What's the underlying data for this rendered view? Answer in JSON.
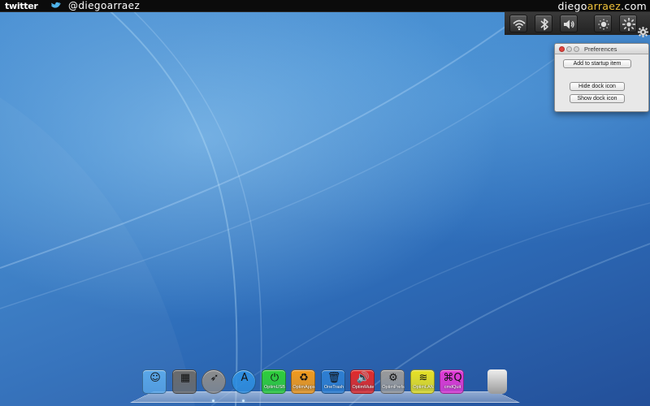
{
  "topbar": {
    "twitter_logo": "twitter",
    "handle": "@diegoarraez",
    "site_white_1": "diego",
    "site_yellow": "arraez",
    "site_white_2": ".com"
  },
  "status_panel": {
    "icons": [
      "wifi-icon",
      "bluetooth-icon",
      "volume-icon",
      "brightness-down-icon",
      "brightness-up-icon",
      "gear-icon"
    ]
  },
  "preferences": {
    "title": "Preferences",
    "add_startup": "Add to startup item",
    "hide_dock": "Hide dock icon",
    "show_dock": "Show dock icon"
  },
  "dock": {
    "items": [
      {
        "name": "finder-icon",
        "label": "",
        "color": "#5aa7e8"
      },
      {
        "name": "dashboard-icon",
        "label": "",
        "color": "#6b6b6b"
      },
      {
        "name": "launchpad-icon",
        "label": "",
        "color": "#8c8c8c"
      },
      {
        "name": "app-store-icon",
        "label": "",
        "color": "#2f8fe0"
      },
      {
        "name": "optimusb-icon",
        "label": "OptimUSB",
        "color": "#2fcf3a"
      },
      {
        "name": "optimapps-icon",
        "label": "OptimApps",
        "color": "#f39a1b"
      },
      {
        "name": "onetrash-icon",
        "label": "OneTrash",
        "color": "#2e7fd2"
      },
      {
        "name": "optimmute-icon",
        "label": "OptimMute",
        "color": "#e12b2b"
      },
      {
        "name": "optimprefs-icon",
        "label": "OptimPrefs",
        "color": "#9a9a9a"
      },
      {
        "name": "optimlan-icon",
        "label": "OptimLAN",
        "color": "#e8e225"
      },
      {
        "name": "cmdquit-icon",
        "label": "cmdQuit",
        "color": "#e23ad6"
      },
      {
        "name": "trash-icon",
        "label": "",
        "color": "#c9c9c9"
      }
    ],
    "glyphs": [
      "☺",
      "▦",
      "➶",
      "A",
      "⏻",
      "♻",
      "🗑",
      "🔊",
      "⚙",
      "≋",
      "⌘Q",
      ""
    ]
  }
}
